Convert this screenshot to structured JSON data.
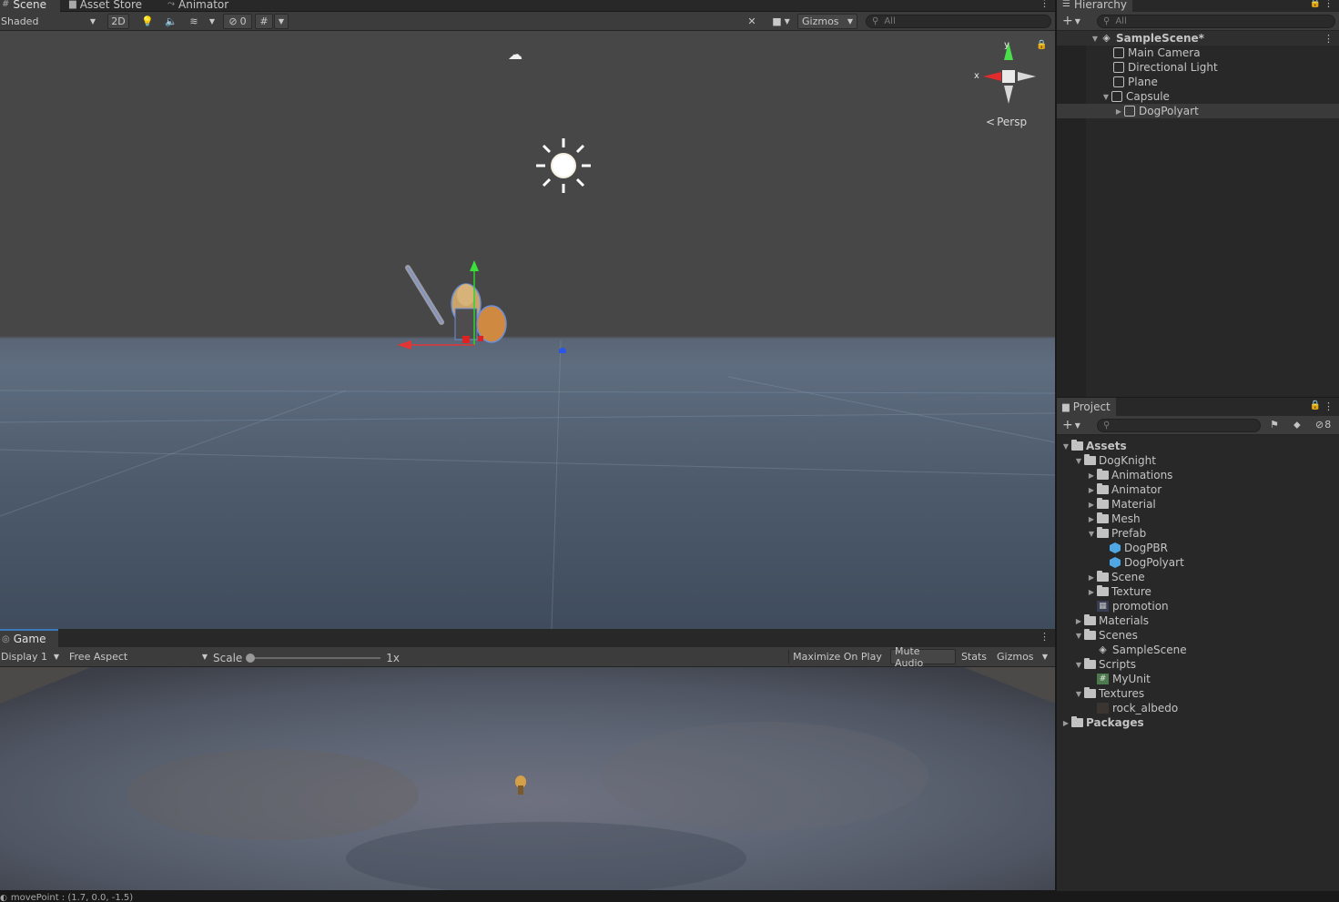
{
  "scene_tabs": {
    "scene": "Scene",
    "asset_store": "Asset Store",
    "animator": "Animator"
  },
  "scene_toolbar": {
    "shading_mode": "Shaded",
    "mode_2d": "2D",
    "hidden_count": "0",
    "gizmos": "Gizmos",
    "search_placeholder": "All"
  },
  "scene_view": {
    "projection": "Persp",
    "axis_x": "x",
    "axis_y": "y"
  },
  "game_tab": {
    "label": "Game"
  },
  "game_toolbar": {
    "display": "Display 1",
    "aspect": "Free Aspect",
    "scale_label": "Scale",
    "scale_value": "1x",
    "maximize_on_play": "Maximize On Play",
    "mute_audio": "Mute Audio",
    "stats": "Stats",
    "gizmos": "Gizmos"
  },
  "hierarchy": {
    "title": "Hierarchy",
    "search_placeholder": "All",
    "scene_name": "SampleScene*",
    "items": [
      {
        "label": "Main Camera"
      },
      {
        "label": "Directional Light"
      },
      {
        "label": "Plane"
      },
      {
        "label": "Capsule"
      },
      {
        "label": "DogPolyart"
      }
    ]
  },
  "project": {
    "title": "Project",
    "hidden_count": "8",
    "tree": [
      {
        "label": "Assets"
      },
      {
        "label": "DogKnight"
      },
      {
        "label": "Animations"
      },
      {
        "label": "Animator"
      },
      {
        "label": "Material"
      },
      {
        "label": "Mesh"
      },
      {
        "label": "Prefab"
      },
      {
        "label": "DogPBR"
      },
      {
        "label": "DogPolyart"
      },
      {
        "label": "Scene"
      },
      {
        "label": "Texture"
      },
      {
        "label": "promotion"
      },
      {
        "label": "Materials"
      },
      {
        "label": "Scenes"
      },
      {
        "label": "SampleScene"
      },
      {
        "label": "Scripts"
      },
      {
        "label": "MyUnit"
      },
      {
        "label": "Textures"
      },
      {
        "label": "rock_albedo"
      },
      {
        "label": "Packages"
      }
    ]
  },
  "status_bar": {
    "message": "movePoint : (1.7, 0.0, -1.5)"
  }
}
